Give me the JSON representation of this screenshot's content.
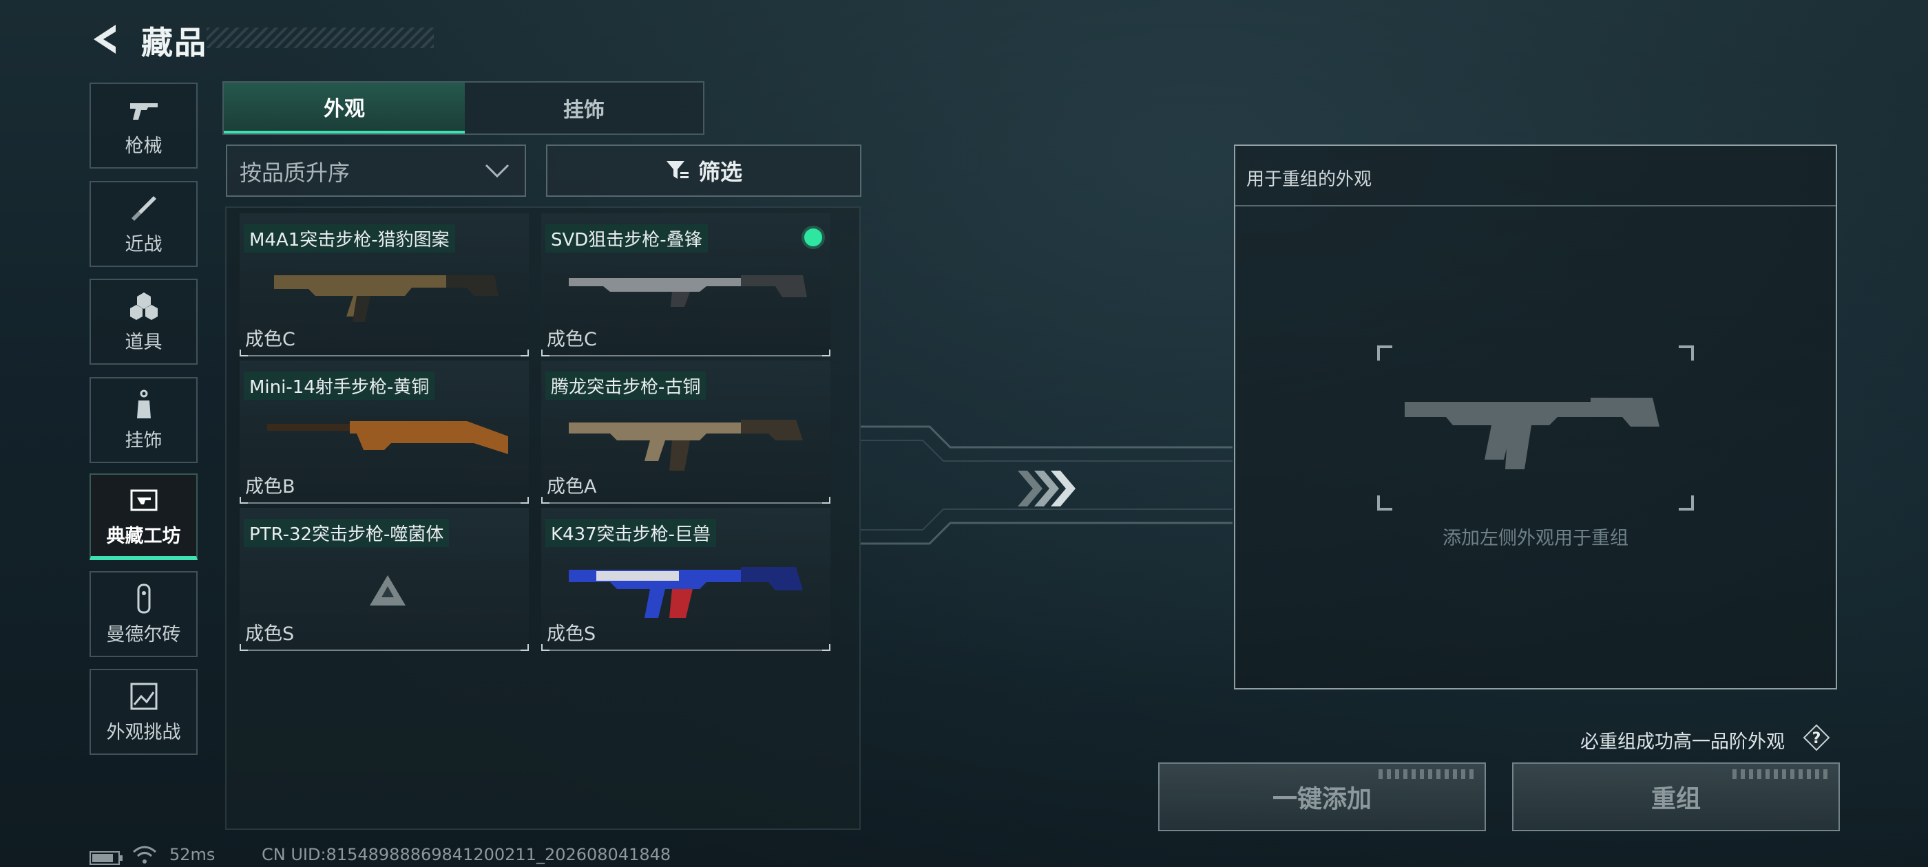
{
  "header": {
    "title": "藏品",
    "back_icon": "back-arrow-icon"
  },
  "nav": [
    {
      "label": "枪械",
      "icon": "gun-icon",
      "active": false
    },
    {
      "label": "近战",
      "icon": "knife-icon",
      "active": false
    },
    {
      "label": "道具",
      "icon": "grenades-icon",
      "active": false
    },
    {
      "label": "挂饰",
      "icon": "charm-icon",
      "active": false
    },
    {
      "label": "典藏工坊",
      "icon": "workshop-icon",
      "active": true
    },
    {
      "label": "曼德尔砖",
      "icon": "brick-icon",
      "active": false
    },
    {
      "label": "外观挑战",
      "icon": "challenge-icon",
      "active": false
    }
  ],
  "tabs": [
    {
      "label": "外观",
      "active": true
    },
    {
      "label": "挂饰",
      "active": false
    }
  ],
  "sort": {
    "value": "按品质升序"
  },
  "filter": {
    "label": "筛选"
  },
  "skins": [
    {
      "name": "M4A1突击步枪-猎豹图案",
      "quality": "成色C",
      "selected": false,
      "colors": [
        "#6b5a3a",
        "#2a2a26"
      ]
    },
    {
      "name": "SVD狙击步枪-叠锋",
      "quality": "成色C",
      "selected": true,
      "colors": [
        "#8a8f93",
        "#3a3d40"
      ]
    },
    {
      "name": "Mini-14射手步枪-黄铜",
      "quality": "成色B",
      "selected": false,
      "colors": [
        "#9a5b22",
        "#3a2a1c"
      ]
    },
    {
      "name": "腾龙突击步枪-古铜",
      "quality": "成色A",
      "selected": false,
      "colors": [
        "#8a7a60",
        "#3b342a"
      ]
    },
    {
      "name": "PTR-32突击步枪-噬菌体",
      "quality": "成色S",
      "selected": false,
      "colors": [
        "#7a8588",
        "#55605f"
      ]
    },
    {
      "name": "K437突击步枪-巨兽",
      "quality": "成色S",
      "selected": false,
      "colors": [
        "#2a44c8",
        "#d8d8e0"
      ]
    }
  ],
  "recombine": {
    "title": "用于重组的外观",
    "hint": "添加左侧外观用于重组",
    "guarantee": "必重组成功高一品阶外观",
    "add_button": "一键添加",
    "recombine_button": "重组"
  },
  "status": {
    "ping": "52ms",
    "uid": "CN UID:81548988869841200211_202608041848"
  },
  "colors": {
    "accent": "#3fe0b2",
    "selected_dot": "#2fe6a0"
  }
}
